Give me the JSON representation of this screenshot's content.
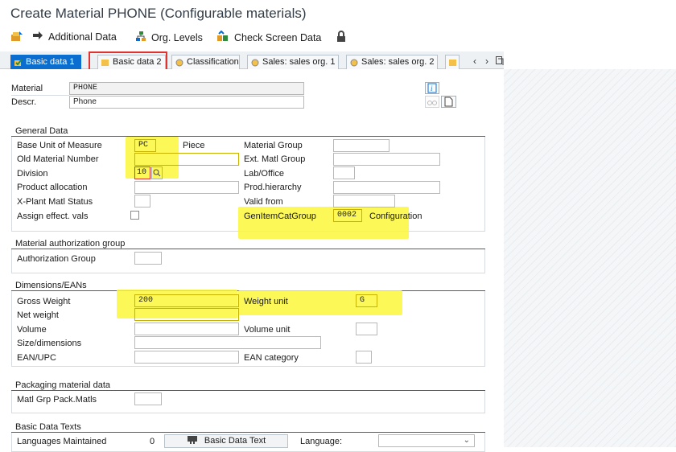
{
  "window": {
    "title": "Create Material PHONE (Configurable materials)"
  },
  "toolbar": {
    "additional_data": "Additional Data",
    "org_levels": "Org. Levels",
    "check_screen_data": "Check Screen Data"
  },
  "tabs": [
    {
      "label": "Basic data 1",
      "active": true
    },
    {
      "label": "Basic data 2",
      "active": false
    },
    {
      "label": "Classification",
      "active": false
    },
    {
      "label": "Sales: sales org. 1",
      "active": false
    },
    {
      "label": "Sales: sales org. 2",
      "active": false
    }
  ],
  "header": {
    "material_label": "Material",
    "material_value": "PHONE",
    "descr_label": "Descr.",
    "descr_value": "Phone"
  },
  "general_data": {
    "title": "General Data",
    "base_uom_label": "Base Unit of Measure",
    "base_uom_value": "PC",
    "base_uom_text": "Piece",
    "old_material_label": "Old Material Number",
    "division_label": "Division",
    "division_value": "10",
    "product_allocation_label": "Product allocation",
    "xplant_status_label": "X-Plant Matl Status",
    "assign_effect_label": "Assign effect. vals",
    "material_group_label": "Material Group",
    "ext_matl_group_label": "Ext. Matl Group",
    "lab_office_label": "Lab/Office",
    "prod_hierarchy_label": "Prod.hierarchy",
    "valid_from_label": "Valid from",
    "gen_item_cat_label": "GenItemCatGroup",
    "gen_item_cat_value": "0002",
    "gen_item_cat_text": "Configuration"
  },
  "auth_group": {
    "title": "Material authorization group",
    "auth_group_label": "Authorization Group"
  },
  "dimensions": {
    "title": "Dimensions/EANs",
    "gross_weight_label": "Gross Weight",
    "gross_weight_value": "200",
    "weight_unit_label": "Weight unit",
    "weight_unit_value": "G",
    "net_weight_label": "Net weight",
    "volume_label": "Volume",
    "volume_unit_label": "Volume unit",
    "size_dim_label": "Size/dimensions",
    "ean_upc_label": "EAN/UPC",
    "ean_category_label": "EAN category"
  },
  "packaging": {
    "title": "Packaging material data",
    "matl_grp_pack_label": "Matl Grp Pack.Matls"
  },
  "basic_texts": {
    "title": "Basic Data Texts",
    "languages_maintained_label": "Languages Maintained",
    "languages_maintained_value": "0",
    "basic_data_text_button": "Basic Data Text",
    "language_label": "Language:"
  },
  "colors": {
    "accent": "#0a6ed1",
    "highlight": "#fbf73a",
    "annotation_red": "#e0322f"
  }
}
